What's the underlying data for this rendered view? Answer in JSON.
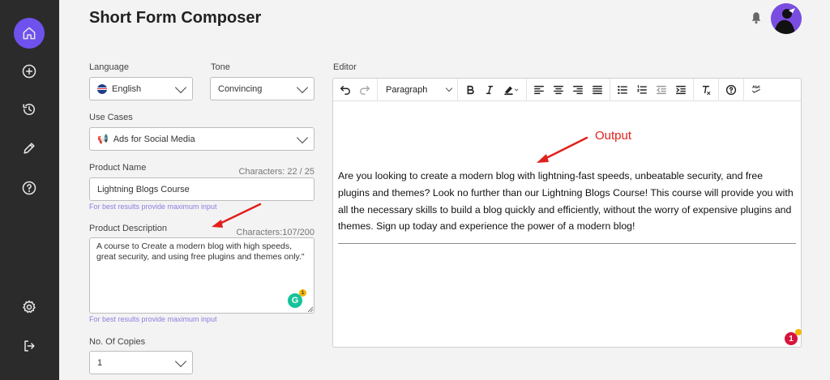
{
  "header": {
    "title": "Short Form Composer"
  },
  "sidebar": {
    "items": [
      {
        "name": "home",
        "icon": "home-icon",
        "active": true
      },
      {
        "name": "add",
        "icon": "plus-circle-icon"
      },
      {
        "name": "history",
        "icon": "history-icon"
      },
      {
        "name": "edit",
        "icon": "pencil-icon"
      },
      {
        "name": "help",
        "icon": "help-circle-icon"
      },
      {
        "name": "settings",
        "icon": "gear-icon"
      },
      {
        "name": "logout",
        "icon": "logout-icon"
      }
    ]
  },
  "form": {
    "language": {
      "label": "Language",
      "value": "English"
    },
    "tone": {
      "label": "Tone",
      "value": "Convincing"
    },
    "use_cases": {
      "label": "Use Cases",
      "value": "Ads for Social Media"
    },
    "product_name": {
      "label": "Product Name",
      "count": "Characters: 22 / 25",
      "value": "Lightning Blogs Course",
      "hint": "For best results provide maximum input"
    },
    "product_description": {
      "label": "Product Description",
      "count": "Characters:107/200",
      "value": "A course to Create a modern blog with high speeds, great security, and using free plugins and themes only.\"",
      "hint": "For best results provide maximum input"
    },
    "copies": {
      "label": "No. Of Copies",
      "value": "1"
    }
  },
  "editor": {
    "label": "Editor",
    "block_format": "Paragraph",
    "output_annotation": "Output",
    "content": "Are you looking to create a modern blog with lightning-fast speeds, unbeatable security, and free plugins and themes? Look no further than our Lightning Blogs Course! This course will provide you with all the necessary skills to build a blog quickly and efficiently, without the worry of expensive plugins and themes. Sign up today and experience the power of a modern blog!",
    "grammar_badge": "1"
  },
  "grammarly_badge": "G",
  "colors": {
    "accent": "#6f52ed",
    "sidebar": "#2b2b2b",
    "annotation": "#e0201c"
  }
}
